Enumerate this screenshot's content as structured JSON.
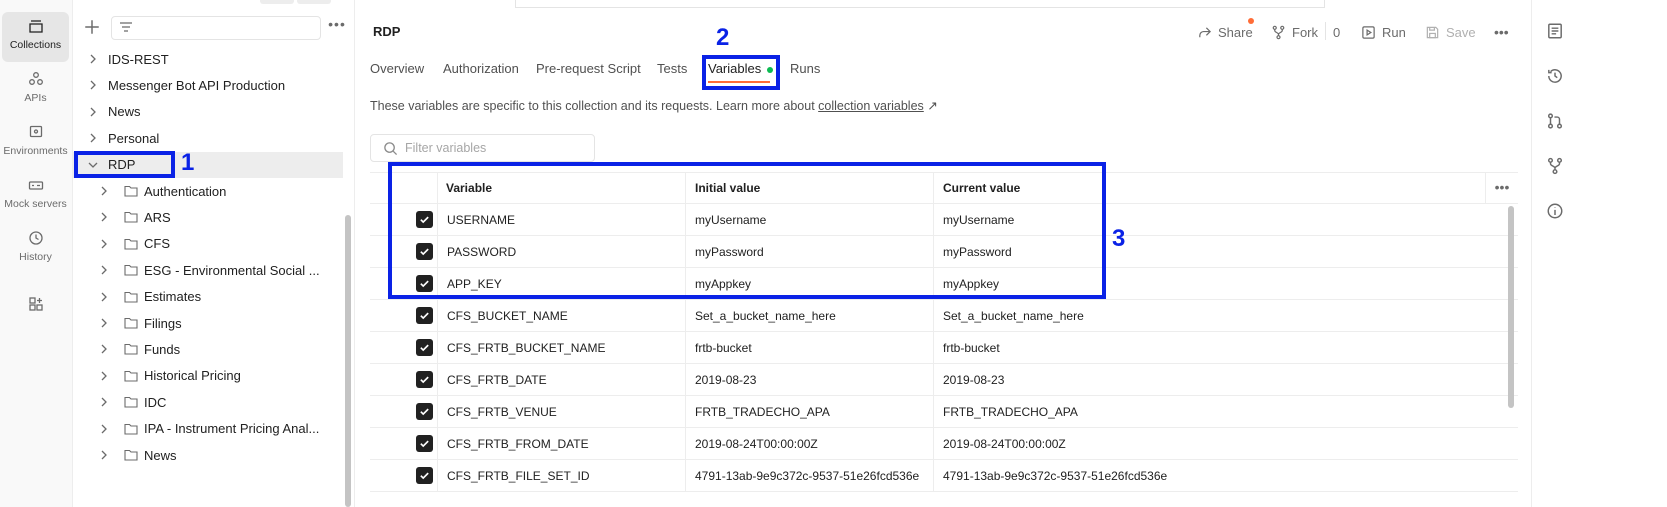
{
  "left_rail": [
    {
      "label": "Collections",
      "icon": "collections-icon"
    },
    {
      "label": "APIs",
      "icon": "apis-icon"
    },
    {
      "label": "Environments",
      "icon": "environments-icon"
    },
    {
      "label": "Mock servers",
      "icon": "mock-servers-icon"
    },
    {
      "label": "History",
      "icon": "history-icon"
    },
    {
      "label": "",
      "icon": "add-workbench-icon"
    }
  ],
  "tree": {
    "collections": [
      {
        "label": "IDS-REST"
      },
      {
        "label": "Messenger Bot API Production"
      },
      {
        "label": "News"
      },
      {
        "label": "Personal"
      },
      {
        "label": "RDP",
        "expanded": true,
        "selected": true
      }
    ],
    "folders": [
      {
        "label": "Authentication"
      },
      {
        "label": "ARS"
      },
      {
        "label": "CFS"
      },
      {
        "label": "ESG - Environmental Social ..."
      },
      {
        "label": "Estimates"
      },
      {
        "label": "Filings"
      },
      {
        "label": "Funds"
      },
      {
        "label": "Historical Pricing"
      },
      {
        "label": "IDC"
      },
      {
        "label": "IPA - Instrument Pricing Anal..."
      },
      {
        "label": "News"
      }
    ]
  },
  "header": {
    "title": "RDP",
    "share_label": "Share",
    "fork_label": "Fork",
    "fork_count": "0",
    "run_label": "Run",
    "save_label": "Save"
  },
  "tabs": [
    {
      "label": "Overview"
    },
    {
      "label": "Authorization"
    },
    {
      "label": "Pre-request Script"
    },
    {
      "label": "Tests"
    },
    {
      "label": "Variables",
      "active": true
    },
    {
      "label": "Runs"
    }
  ],
  "description": {
    "text": "These variables are specific to this collection and its requests. Learn more about",
    "link": "collection variables",
    "arrow": "↗"
  },
  "filter": {
    "placeholder": "Filter variables"
  },
  "variables": {
    "columns": [
      "Variable",
      "Initial value",
      "Current value"
    ],
    "rows": [
      {
        "checked": true,
        "name": "USERNAME",
        "initial": "myUsername",
        "current": "myUsername"
      },
      {
        "checked": true,
        "name": "PASSWORD",
        "initial": "myPassword",
        "current": "myPassword"
      },
      {
        "checked": true,
        "name": "APP_KEY",
        "initial": "myAppkey",
        "current": "myAppkey"
      },
      {
        "checked": true,
        "name": "CFS_BUCKET_NAME",
        "initial": "Set_a_bucket_name_here",
        "current": "Set_a_bucket_name_here"
      },
      {
        "checked": true,
        "name": "CFS_FRTB_BUCKET_NAME",
        "initial": "frtb-bucket",
        "current": "frtb-bucket"
      },
      {
        "checked": true,
        "name": "CFS_FRTB_DATE",
        "initial": "2019-08-23",
        "current": "2019-08-23"
      },
      {
        "checked": true,
        "name": "CFS_FRTB_VENUE",
        "initial": "FRTB_TRADECHO_APA",
        "current": "FRTB_TRADECHO_APA"
      },
      {
        "checked": true,
        "name": "CFS_FRTB_FROM_DATE",
        "initial": "2019-08-24T00:00:00Z",
        "current": "2019-08-24T00:00:00Z"
      },
      {
        "checked": true,
        "name": "CFS_FRTB_FILE_SET_ID",
        "initial": "4791-13ab-9e9c372c-9537-51e26fcd536e",
        "current": "4791-13ab-9e9c372c-9537-51e26fcd536e"
      }
    ]
  },
  "annotations": [
    "1",
    "2",
    "3"
  ],
  "colors": {
    "accent": "#ff6c37",
    "annotation": "#0a22e6",
    "active_dot": "#0cbb52"
  }
}
